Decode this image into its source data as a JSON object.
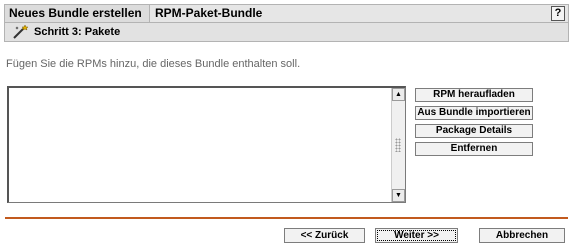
{
  "header": {
    "left_title": "Neues Bundle erstellen",
    "right_title": "RPM-Paket-Bundle",
    "help_label": "?"
  },
  "step": {
    "icon": "wand-icon",
    "title": "Schritt 3: Pakete"
  },
  "instruction": "Fügen Sie die RPMs hinzu, die dieses Bundle enthalten soll.",
  "rpm_list": {
    "items": []
  },
  "side_buttons": {
    "upload": "RPM heraufladen",
    "import": "Aus Bundle importieren",
    "details": "Package Details",
    "remove": "Entfernen"
  },
  "footer": {
    "back": "<< Zurück",
    "next": "Weiter >>",
    "cancel": "Abbrechen"
  },
  "colors": {
    "divider": "#c25a1e",
    "header_bg": "#e6e6e6"
  }
}
